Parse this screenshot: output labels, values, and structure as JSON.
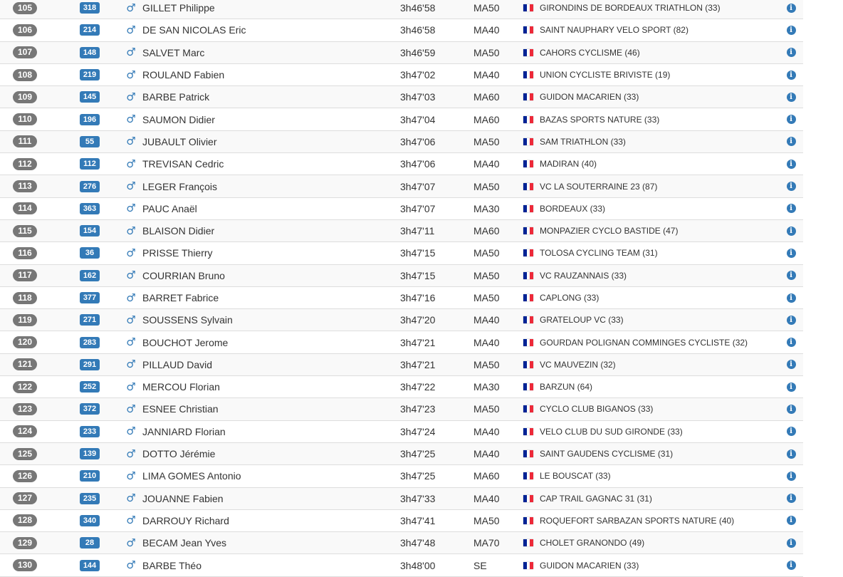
{
  "results": [
    {
      "rank": "105",
      "bib": "318",
      "name": "GILLET Philippe",
      "time": "3h46'58",
      "category": "MA50",
      "club": "GIRONDINS DE BORDEAUX TRIATHLON (33)"
    },
    {
      "rank": "106",
      "bib": "214",
      "name": "DE SAN NICOLAS Eric",
      "time": "3h46'58",
      "category": "MA40",
      "club": "SAINT NAUPHARY VELO SPORT (82)"
    },
    {
      "rank": "107",
      "bib": "148",
      "name": "SALVET Marc",
      "time": "3h46'59",
      "category": "MA50",
      "club": "CAHORS CYCLISME (46)"
    },
    {
      "rank": "108",
      "bib": "219",
      "name": "ROULAND Fabien",
      "time": "3h47'02",
      "category": "MA40",
      "club": "UNION CYCLISTE BRIVISTE (19)"
    },
    {
      "rank": "109",
      "bib": "145",
      "name": "BARBE Patrick",
      "time": "3h47'03",
      "category": "MA60",
      "club": "GUIDON MACARIEN (33)"
    },
    {
      "rank": "110",
      "bib": "196",
      "name": "SAUMON Didier",
      "time": "3h47'04",
      "category": "MA60",
      "club": "BAZAS SPORTS NATURE (33)"
    },
    {
      "rank": "111",
      "bib": "55",
      "name": "JUBAULT Olivier",
      "time": "3h47'06",
      "category": "MA50",
      "club": "SAM TRIATHLON (33)"
    },
    {
      "rank": "112",
      "bib": "112",
      "name": "TREVISAN Cedric",
      "time": "3h47'06",
      "category": "MA40",
      "club": "MADIRAN (40)"
    },
    {
      "rank": "113",
      "bib": "276",
      "name": "LEGER François",
      "time": "3h47'07",
      "category": "MA50",
      "club": "VC LA SOUTERRAINE 23 (87)"
    },
    {
      "rank": "114",
      "bib": "363",
      "name": "PAUC Anaël",
      "time": "3h47'07",
      "category": "MA30",
      "club": "BORDEAUX (33)"
    },
    {
      "rank": "115",
      "bib": "154",
      "name": "BLAISON Didier",
      "time": "3h47'11",
      "category": "MA60",
      "club": "MONPAZIER CYCLO BASTIDE (47)"
    },
    {
      "rank": "116",
      "bib": "36",
      "name": "PRISSE Thierry",
      "time": "3h47'15",
      "category": "MA50",
      "club": "TOLOSA CYCLING TEAM (31)"
    },
    {
      "rank": "117",
      "bib": "162",
      "name": "COURRIAN Bruno",
      "time": "3h47'15",
      "category": "MA50",
      "club": "VC RAUZANNAIS (33)"
    },
    {
      "rank": "118",
      "bib": "377",
      "name": "BARRET Fabrice",
      "time": "3h47'16",
      "category": "MA50",
      "club": "CAPLONG (33)"
    },
    {
      "rank": "119",
      "bib": "271",
      "name": "SOUSSENS Sylvain",
      "time": "3h47'20",
      "category": "MA40",
      "club": "GRATELOUP VC (33)"
    },
    {
      "rank": "120",
      "bib": "283",
      "name": "BOUCHOT Jerome",
      "time": "3h47'21",
      "category": "MA40",
      "club": "GOURDAN POLIGNAN COMMINGES CYCLISTE (32)"
    },
    {
      "rank": "121",
      "bib": "291",
      "name": "PILLAUD David",
      "time": "3h47'21",
      "category": "MA50",
      "club": "VC MAUVEZIN (32)"
    },
    {
      "rank": "122",
      "bib": "252",
      "name": "MERCOU Florian",
      "time": "3h47'22",
      "category": "MA30",
      "club": "BARZUN (64)"
    },
    {
      "rank": "123",
      "bib": "372",
      "name": "ESNEE Christian",
      "time": "3h47'23",
      "category": "MA50",
      "club": "CYCLO CLUB BIGANOS (33)"
    },
    {
      "rank": "124",
      "bib": "233",
      "name": "JANNIARD Florian",
      "time": "3h47'24",
      "category": "MA40",
      "club": "VELO CLUB DU SUD GIRONDE (33)"
    },
    {
      "rank": "125",
      "bib": "139",
      "name": "DOTTO Jérémie",
      "time": "3h47'25",
      "category": "MA40",
      "club": "SAINT GAUDENS CYCLISME (31)"
    },
    {
      "rank": "126",
      "bib": "210",
      "name": "LIMA GOMES Antonio",
      "time": "3h47'25",
      "category": "MA60",
      "club": "LE BOUSCAT (33)"
    },
    {
      "rank": "127",
      "bib": "235",
      "name": "JOUANNE Fabien",
      "time": "3h47'33",
      "category": "MA40",
      "club": "CAP TRAIL GAGNAC 31 (31)"
    },
    {
      "rank": "128",
      "bib": "340",
      "name": "DARROUY Richard",
      "time": "3h47'41",
      "category": "MA50",
      "club": "ROQUEFORT SARBAZAN SPORTS NATURE (40)"
    },
    {
      "rank": "129",
      "bib": "28",
      "name": "BECAM Jean Yves",
      "time": "3h47'48",
      "category": "MA70",
      "club": "CHOLET GRANONDO (49)"
    },
    {
      "rank": "130",
      "bib": "144",
      "name": "BARBE Théo",
      "time": "3h48'00",
      "category": "SE",
      "club": "GUIDON MACARIEN (33)"
    }
  ],
  "icons": {
    "gender": "male-icon",
    "nationality": "france-flag-icon",
    "details": "info-icon"
  },
  "colors": {
    "rank_badge": "#777777",
    "bib_badge": "#337ab7",
    "male_icon": "#337ab7",
    "info_icon": "#337ab7",
    "row_stripe": "#f9f9f9",
    "row_border": "#dddddd"
  }
}
